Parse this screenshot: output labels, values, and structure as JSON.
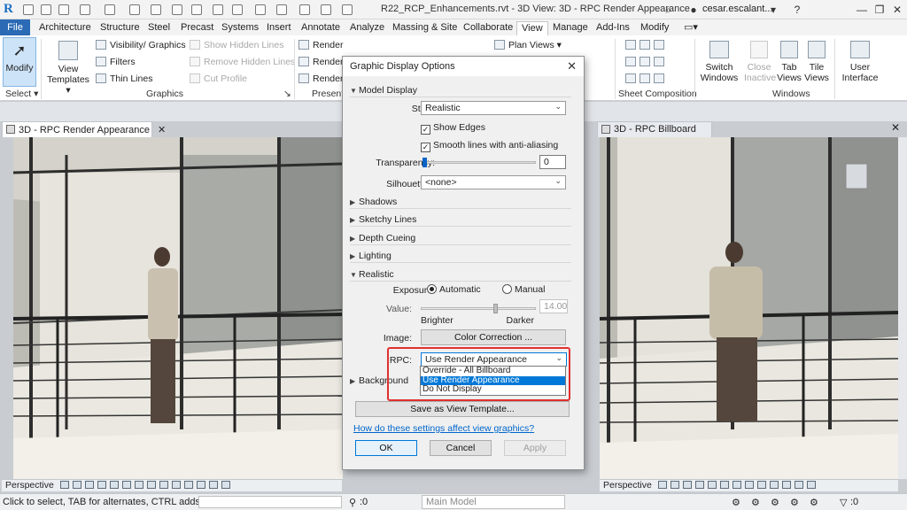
{
  "window": {
    "title": "R22_RCP_Enhancements.rvt - 3D View: 3D - RPC Render Appearance",
    "user": "cesar.escalant..."
  },
  "ribbon": {
    "tabs": [
      "File",
      "Architecture",
      "Structure",
      "Steel",
      "Precast",
      "Systems",
      "Insert",
      "Annotate",
      "Analyze",
      "Massing & Site",
      "Collaborate",
      "View",
      "Manage",
      "Add-Ins",
      "Modify"
    ],
    "active_tab": "View",
    "modify_label": "Modify",
    "select_label": "Select ▾",
    "view_templates_label": "View Templates ▾",
    "visibility_graphics": "Visibility/ Graphics",
    "filters": "Filters",
    "thin_lines": "Thin Lines",
    "show_hidden_lines": "Show Hidden Lines",
    "remove_hidden_lines": "Remove Hidden Lines",
    "cut_profile": "Cut Profile",
    "graphics_panel": "Graphics",
    "render1": "Render",
    "render2": "Render",
    "render3": "Render",
    "presentation_panel": "Present",
    "plan_views": "Plan Views ▾",
    "sheet_composition_panel": "Sheet Composition",
    "switch_windows": "Switch Windows",
    "close_inactive": "Close Inactive",
    "tab_views": "Tab Views",
    "tile_views": "Tile Views",
    "user_interface": "User Interface",
    "windows_panel": "Windows"
  },
  "views": {
    "left_tab": "3D - RPC Render Appearance",
    "right_tab": "3D - RPC Billboard",
    "left_bar": "Perspective",
    "right_bar": "Perspective"
  },
  "dialog": {
    "title": "Graphic Display Options",
    "model_display": "Model Display",
    "style_label": "Style:",
    "style_value": "Realistic",
    "show_edges": "Show Edges",
    "smooth_lines": "Smooth lines with anti-aliasing",
    "transparency_label": "Transparency:",
    "transparency_value": "0",
    "silhouettes_label": "Silhouettes:",
    "silhouettes_value": "<none>",
    "shadows": "Shadows",
    "sketchy_lines": "Sketchy Lines",
    "depth_cueing": "Depth Cueing",
    "lighting": "Lighting",
    "realistic": "Realistic",
    "exposure_label": "Exposure:",
    "exposure_auto": "Automatic",
    "exposure_manual": "Manual",
    "value_label": "Value:",
    "value_value": "14.00",
    "brighter": "Brighter",
    "darker": "Darker",
    "image_label": "Image:",
    "color_correction": "Color Correction ...",
    "rpc_label": "RPC:",
    "rpc_value": "Use Render Appearance",
    "rpc_options": [
      "Override - All Billboard",
      "Use Render Appearance",
      "Do Not Display"
    ],
    "background": "Background",
    "save_template": "Save as View Template...",
    "help_link": "How do these settings affect view graphics?",
    "ok": "OK",
    "cancel": "Cancel",
    "apply": "Apply"
  },
  "status": {
    "hint": "Click to select, TAB for alternates, CTRL adds, Sh",
    "count": ":0",
    "model": "Main Model",
    "count2": ":0"
  }
}
